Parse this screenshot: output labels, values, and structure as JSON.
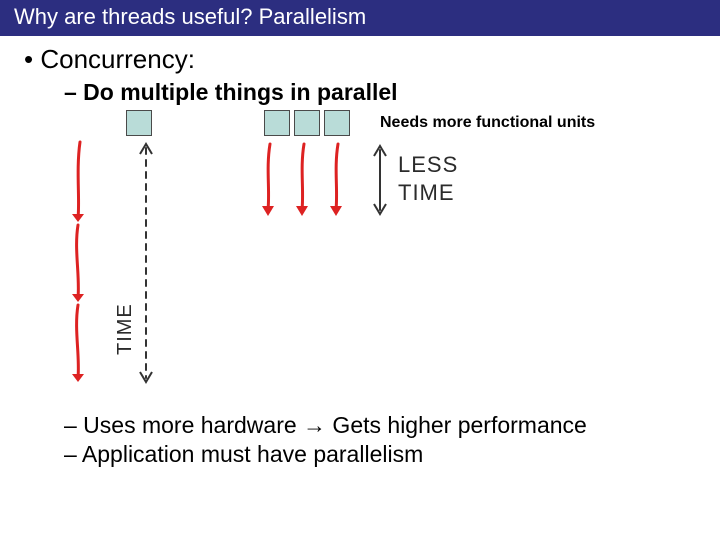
{
  "title": "Why are threads useful? Parallelism",
  "bullets": {
    "l1": "• Concurrency:",
    "l2a": "– Do multiple things in parallel",
    "note": "Needs more functional units",
    "l2b": "– Uses more hardware ",
    "l2b_tail": " Gets higher performance",
    "l2c": "– Application must have parallelism"
  },
  "hand": {
    "time": "TIME",
    "less": "LESS",
    "time2": "TIME"
  }
}
